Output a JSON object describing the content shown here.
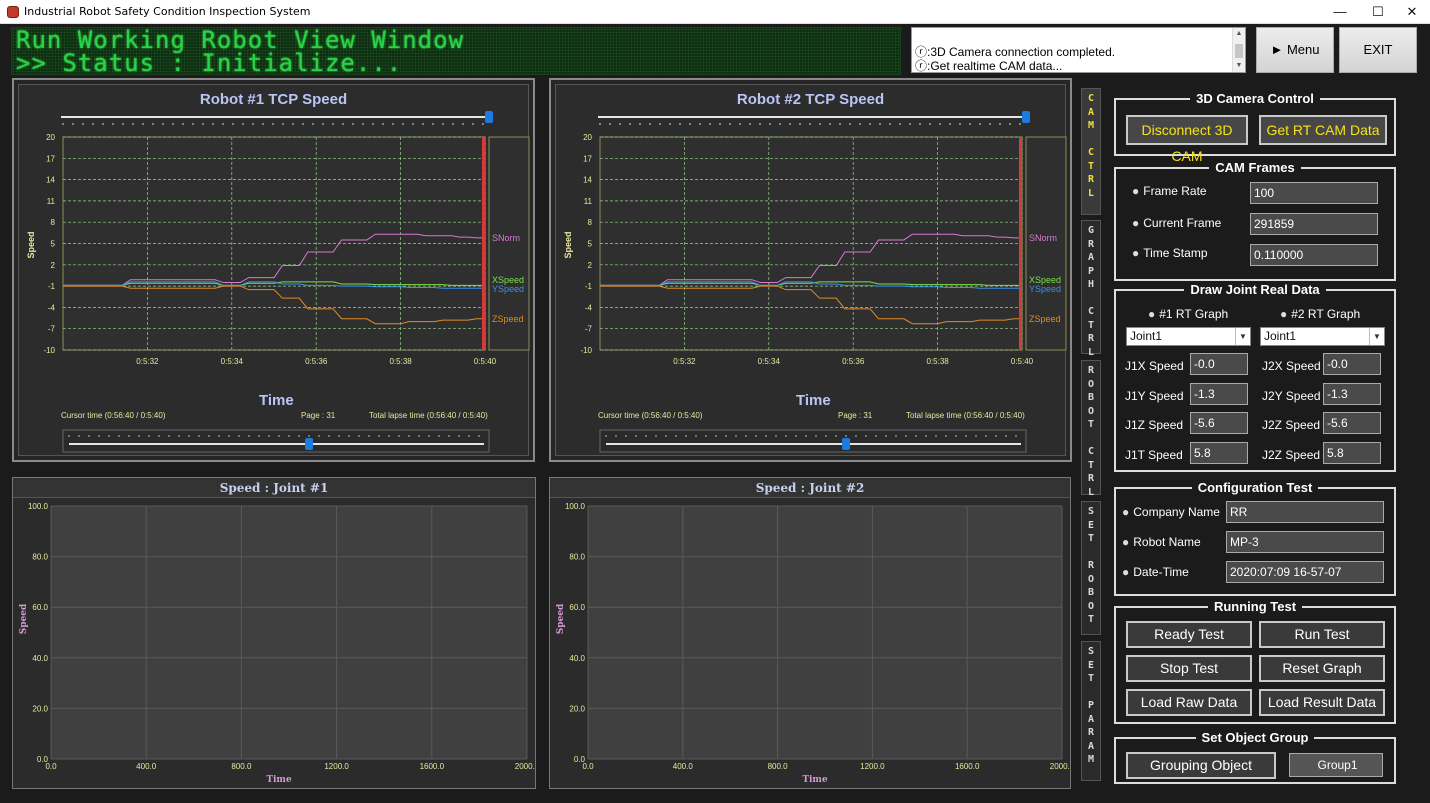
{
  "window": {
    "title": "Industrial Robot Safety Condition Inspection System",
    "minimize": "—",
    "maximize": "☐",
    "close": "✕"
  },
  "header": {
    "led_line1": "Run Working Robot View Window",
    "led_line2": ">> Status : Initialize...",
    "log": [
      "ⓡ:3D Camera connection completed.",
      "ⓡ:Get realtime CAM data..."
    ],
    "menu_button": "► Menu",
    "exit_button": "EXIT"
  },
  "tcp_charts": [
    {
      "title": "Robot #1 TCP Speed",
      "ylabel": "Speed",
      "xlabel": "Time",
      "cursor_time": "Cursor time (0:56:40 / 0:5:40)",
      "page": "Page : 31",
      "total_lapse": "Total lapse time (0:56:40 / 0:5:40)"
    },
    {
      "title": "Robot #2 TCP Speed",
      "ylabel": "Speed",
      "xlabel": "Time",
      "cursor_time": "Cursor time (0:56:40 / 0:5:40)",
      "page": "Page : 31",
      "total_lapse": "Total lapse time (0:56:40 / 0:5:40)"
    }
  ],
  "joint_charts": [
    {
      "title": "Speed : Joint #1",
      "ylabel": "Speed",
      "xlabel": "Time"
    },
    {
      "title": "Speed : Joint #2",
      "ylabel": "Speed",
      "xlabel": "Time"
    }
  ],
  "chart_data": [
    {
      "type": "line",
      "title": "Robot #1 TCP Speed",
      "xlabel": "Time",
      "ylabel": "Speed",
      "x_ticks": [
        "0:5:32",
        "0:5:34",
        "0:5:36",
        "0:5:38",
        "0:5:40"
      ],
      "y_ticks": [
        20,
        17,
        14,
        11,
        8,
        5,
        2,
        -1,
        -4,
        -7,
        -10
      ],
      "ylim": [
        -10,
        20
      ],
      "grid": true,
      "legend": "right",
      "x": [
        0,
        0.2,
        0.4,
        0.6,
        0.8,
        1,
        1.2,
        1.4,
        1.6,
        1.8,
        2,
        2.2,
        2.4,
        2.6,
        2.8,
        3,
        3.2,
        3.4,
        3.6,
        3.8,
        4,
        4.2,
        4.4,
        4.6,
        4.8,
        5,
        5.2,
        5.4,
        5.6,
        5.8,
        6,
        6.2,
        6.4,
        6.6,
        6.8,
        7,
        7.2,
        7.4,
        7.6,
        7.8,
        8,
        8.2,
        8.4,
        8.6,
        8.8,
        9,
        9.2,
        9.4,
        9.6,
        9.8,
        10
      ],
      "series": [
        {
          "name": "SNorm",
          "color": "#d67ad6",
          "values": [
            -0.9,
            -0.9,
            -0.9,
            -0.9,
            -0.9,
            -0.9,
            -0.9,
            -0.9,
            -0.1,
            -0.1,
            -0.1,
            -0.1,
            -0.1,
            -0.1,
            -0.1,
            -0.1,
            -0.1,
            -0.1,
            -0.1,
            -0.5,
            -0.5,
            -0.5,
            0.2,
            0.2,
            0.2,
            0.2,
            1.9,
            1.9,
            1.9,
            3.8,
            3.8,
            3.8,
            3.8,
            5.5,
            5.5,
            5.5,
            5.5,
            6.3,
            6.3,
            6.3,
            6.3,
            6.3,
            6.3,
            6.1,
            6.1,
            6.1,
            6.1,
            5.9,
            5.9,
            5.8,
            5.8
          ]
        },
        {
          "name": "XSpeed",
          "color": "#7be04a",
          "values": [
            -0.9,
            -0.9,
            -0.9,
            -0.9,
            -0.9,
            -0.9,
            -0.9,
            -0.9,
            -0.6,
            -0.6,
            -0.6,
            -0.6,
            -0.6,
            -0.6,
            -0.6,
            -0.6,
            -0.6,
            -0.6,
            -0.6,
            -0.9,
            -0.9,
            -0.9,
            -0.6,
            -0.6,
            -0.6,
            -0.6,
            -0.4,
            -0.4,
            -0.4,
            -0.4,
            -0.4,
            -0.4,
            -0.4,
            -0.7,
            -0.7,
            -0.7,
            -0.7,
            -0.8,
            -0.8,
            -0.8,
            -0.8,
            -0.8,
            -0.8,
            -0.8,
            -0.8,
            -0.8,
            -0.9,
            -0.9,
            -0.9,
            -0.9,
            -0.9
          ]
        },
        {
          "name": "YSpeed",
          "color": "#3d8ef0",
          "values": [
            -0.9,
            -0.9,
            -0.9,
            -0.9,
            -0.9,
            -0.9,
            -0.9,
            -0.9,
            -0.4,
            -0.4,
            -0.4,
            -0.4,
            -0.4,
            -0.4,
            -0.4,
            -0.4,
            -0.4,
            -0.4,
            -0.4,
            -0.9,
            -0.9,
            -0.9,
            -0.4,
            -0.4,
            -0.4,
            -0.4,
            -0.7,
            -0.7,
            -0.7,
            -0.9,
            -0.9,
            -0.9,
            -0.9,
            -1.0,
            -1.0,
            -1.0,
            -1.0,
            -1.1,
            -1.1,
            -1.1,
            -1.1,
            -1.2,
            -1.2,
            -1.2,
            -1.2,
            -1.3,
            -1.3,
            -1.3,
            -1.3,
            -1.3,
            -1.3
          ]
        },
        {
          "name": "ZSpeed",
          "color": "#e08a2a",
          "values": [
            -1.0,
            -1.0,
            -1.0,
            -1.0,
            -1.0,
            -1.0,
            -1.0,
            -1.0,
            -1.3,
            -1.3,
            -1.3,
            -1.3,
            -1.3,
            -1.3,
            -1.3,
            -1.3,
            -1.3,
            -1.3,
            -1.3,
            -1.0,
            -1.0,
            -1.0,
            -1.5,
            -1.5,
            -1.5,
            -1.5,
            -2.7,
            -2.7,
            -2.7,
            -4.2,
            -4.2,
            -4.2,
            -4.2,
            -5.6,
            -5.6,
            -5.6,
            -5.6,
            -6.3,
            -6.3,
            -6.3,
            -6.3,
            -6.0,
            -6.0,
            -6.0,
            -6.0,
            -5.8,
            -5.8,
            -5.8,
            -5.8,
            -5.6,
            -5.6
          ]
        }
      ]
    },
    {
      "type": "line",
      "title": "Robot #2 TCP Speed",
      "xlabel": "Time",
      "ylabel": "Speed",
      "x_ticks": [
        "0:5:32",
        "0:5:34",
        "0:5:36",
        "0:5:38",
        "0:5:40"
      ],
      "y_ticks": [
        20,
        17,
        14,
        11,
        8,
        5,
        2,
        -1,
        -4,
        -7,
        -10
      ],
      "ylim": [
        -10,
        20
      ],
      "grid": true,
      "legend": "right",
      "x": [
        0,
        0.2,
        0.4,
        0.6,
        0.8,
        1,
        1.2,
        1.4,
        1.6,
        1.8,
        2,
        2.2,
        2.4,
        2.6,
        2.8,
        3,
        3.2,
        3.4,
        3.6,
        3.8,
        4,
        4.2,
        4.4,
        4.6,
        4.8,
        5,
        5.2,
        5.4,
        5.6,
        5.8,
        6,
        6.2,
        6.4,
        6.6,
        6.8,
        7,
        7.2,
        7.4,
        7.6,
        7.8,
        8,
        8.2,
        8.4,
        8.6,
        8.8,
        9,
        9.2,
        9.4,
        9.6,
        9.8,
        10
      ],
      "series": [
        {
          "name": "SNorm",
          "color": "#d67ad6",
          "values": [
            -0.9,
            -0.9,
            -0.9,
            -0.9,
            -0.9,
            -0.9,
            -0.9,
            -0.9,
            -0.1,
            -0.1,
            -0.1,
            -0.1,
            -0.1,
            -0.1,
            -0.1,
            -0.1,
            -0.1,
            -0.1,
            -0.1,
            -0.5,
            -0.5,
            -0.5,
            0.2,
            0.2,
            0.2,
            0.2,
            1.9,
            1.9,
            1.9,
            3.8,
            3.8,
            3.8,
            3.8,
            5.5,
            5.5,
            5.5,
            5.5,
            6.3,
            6.3,
            6.3,
            6.3,
            6.3,
            6.3,
            6.1,
            6.1,
            6.1,
            6.1,
            5.9,
            5.9,
            5.8,
            5.8
          ]
        },
        {
          "name": "XSpeed",
          "color": "#7be04a",
          "values": [
            -0.9,
            -0.9,
            -0.9,
            -0.9,
            -0.9,
            -0.9,
            -0.9,
            -0.9,
            -0.6,
            -0.6,
            -0.6,
            -0.6,
            -0.6,
            -0.6,
            -0.6,
            -0.6,
            -0.6,
            -0.6,
            -0.6,
            -0.9,
            -0.9,
            -0.9,
            -0.6,
            -0.6,
            -0.6,
            -0.6,
            -0.4,
            -0.4,
            -0.4,
            -0.4,
            -0.4,
            -0.4,
            -0.4,
            -0.7,
            -0.7,
            -0.7,
            -0.7,
            -0.8,
            -0.8,
            -0.8,
            -0.8,
            -0.8,
            -0.8,
            -0.8,
            -0.8,
            -0.8,
            -0.9,
            -0.9,
            -0.9,
            -0.9,
            -0.9
          ]
        },
        {
          "name": "YSpeed",
          "color": "#3d8ef0",
          "values": [
            -0.9,
            -0.9,
            -0.9,
            -0.9,
            -0.9,
            -0.9,
            -0.9,
            -0.9,
            -0.4,
            -0.4,
            -0.4,
            -0.4,
            -0.4,
            -0.4,
            -0.4,
            -0.4,
            -0.4,
            -0.4,
            -0.4,
            -0.9,
            -0.9,
            -0.9,
            -0.4,
            -0.4,
            -0.4,
            -0.4,
            -0.7,
            -0.7,
            -0.7,
            -0.9,
            -0.9,
            -0.9,
            -0.9,
            -1.0,
            -1.0,
            -1.0,
            -1.0,
            -1.1,
            -1.1,
            -1.1,
            -1.1,
            -1.2,
            -1.2,
            -1.2,
            -1.2,
            -1.3,
            -1.3,
            -1.3,
            -1.3,
            -1.3,
            -1.3
          ]
        },
        {
          "name": "ZSpeed",
          "color": "#e08a2a",
          "values": [
            -1.0,
            -1.0,
            -1.0,
            -1.0,
            -1.0,
            -1.0,
            -1.0,
            -1.0,
            -1.3,
            -1.3,
            -1.3,
            -1.3,
            -1.3,
            -1.3,
            -1.3,
            -1.3,
            -1.3,
            -1.3,
            -1.3,
            -1.0,
            -1.0,
            -1.0,
            -1.5,
            -1.5,
            -1.5,
            -1.5,
            -2.7,
            -2.7,
            -2.7,
            -4.2,
            -4.2,
            -4.2,
            -4.2,
            -5.6,
            -5.6,
            -5.6,
            -5.6,
            -6.3,
            -6.3,
            -6.3,
            -6.3,
            -6.0,
            -6.0,
            -6.0,
            -6.0,
            -5.8,
            -5.8,
            -5.8,
            -5.8,
            -5.6,
            -5.6
          ]
        }
      ]
    },
    {
      "type": "line",
      "title": "Speed : Joint #1",
      "xlabel": "Time",
      "ylabel": "Speed",
      "x_ticks": [
        "0.0",
        "400.0",
        "800.0",
        "1200.0",
        "1600.0",
        "2000.0"
      ],
      "y_ticks": [
        "100.0",
        "80.0",
        "60.0",
        "40.0",
        "20.0",
        "0.0"
      ],
      "xlim": [
        0,
        2000
      ],
      "ylim": [
        0,
        100
      ],
      "grid": true,
      "series": []
    },
    {
      "type": "line",
      "title": "Speed : Joint #2",
      "xlabel": "Time",
      "ylabel": "Speed",
      "x_ticks": [
        "0.0",
        "400.0",
        "800.0",
        "1200.0",
        "1600.0",
        "2000.0"
      ],
      "y_ticks": [
        "100.0",
        "80.0",
        "60.0",
        "40.0",
        "20.0",
        "0.0"
      ],
      "xlim": [
        0,
        2000
      ],
      "ylim": [
        0,
        100
      ],
      "grid": true,
      "series": []
    }
  ],
  "side_tabs": [
    {
      "text": "CAM CTRL",
      "color": "#f3df3a"
    },
    {
      "text": "GRAPH CTRL",
      "color": "#d9d9d9"
    },
    {
      "text": "ROBOT CTRL",
      "color": "#d9d9d9"
    },
    {
      "text": "SET ROBOT",
      "color": "#d9d9d9"
    },
    {
      "text": "SET PARAM",
      "color": "#d9d9d9"
    }
  ],
  "cam_control": {
    "title": "3D Camera Control",
    "disconnect": "Disconnect 3D CAM",
    "get_rt": "Get RT CAM Data"
  },
  "cam_frames": {
    "title": "CAM Frames",
    "frame_rate_label": "Frame Rate",
    "frame_rate": "100",
    "current_frame_label": "Current Frame",
    "current_frame": "291859",
    "time_stamp_label": "Time Stamp",
    "time_stamp": "0.110000"
  },
  "draw_joint": {
    "title": "Draw Joint Real Data",
    "graph1_label": "#1 RT Graph",
    "graph2_label": "#2 RT Graph",
    "graph1_select": "Joint1",
    "graph2_select": "Joint1",
    "j1x_label": "J1X Speed",
    "j1x": "-0.0",
    "j1y_label": "J1Y Speed",
    "j1y": "-1.3",
    "j1z_label": "J1Z Speed",
    "j1z": "-5.6",
    "j1t_label": "J1T Speed",
    "j1t": "5.8",
    "j2x_label": "J2X Speed",
    "j2x": "-0.0",
    "j2y_label": "J2Y Speed",
    "j2y": "-1.3",
    "j2z_label": "J2Z Speed",
    "j2z": "-5.6",
    "j2t_label": "J2Z Speed",
    "j2t": "5.8"
  },
  "config_test": {
    "title": "Configuration Test",
    "company_label": "Company Name",
    "company": "RR",
    "robot_label": "Robot Name",
    "robot": "MP-3",
    "datetime_label": "Date-Time",
    "datetime": "2020:07:09 16-57-07"
  },
  "running_test": {
    "title": "Running Test",
    "ready": "Ready Test",
    "run": "Run Test",
    "stop": "Stop Test",
    "reset": "Reset Graph",
    "load_raw": "Load Raw Data",
    "load_result": "Load Result Data"
  },
  "object_group": {
    "title": "Set Object Group",
    "grouping": "Grouping Object",
    "group_value": "Group1"
  }
}
